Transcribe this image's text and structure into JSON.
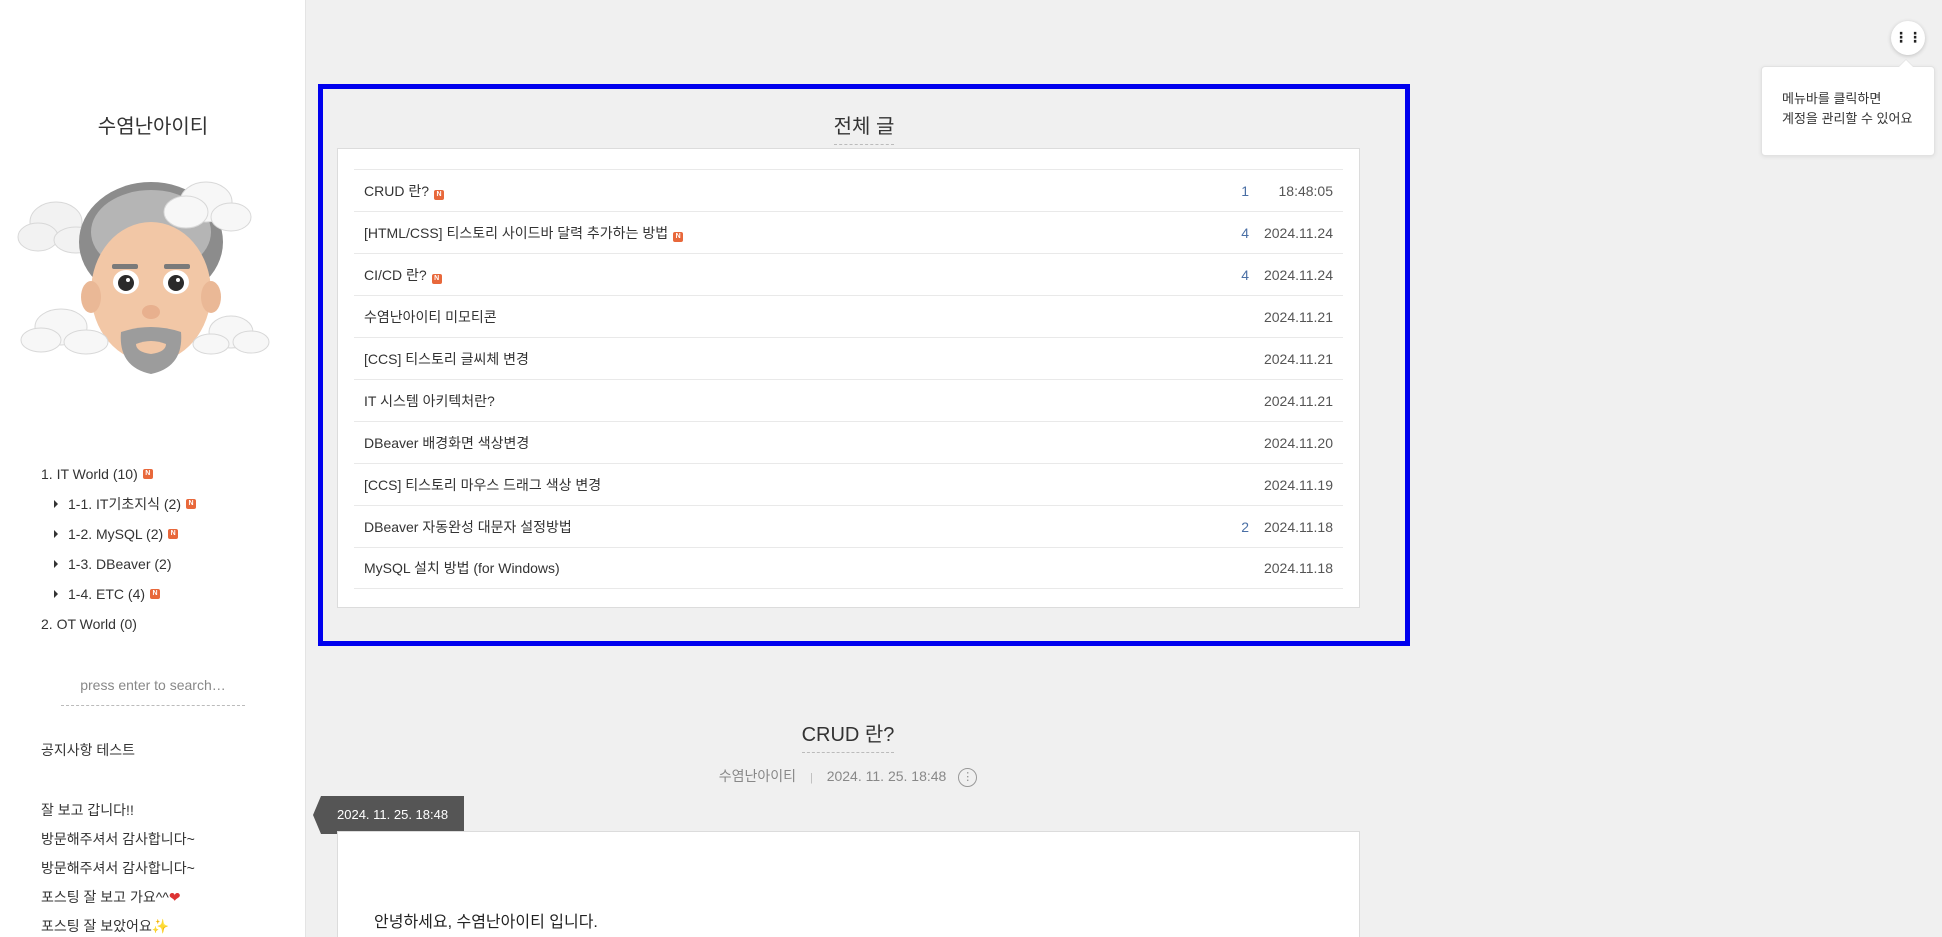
{
  "blog": {
    "title": "수염난아이티",
    "avatar": "memoji-avatar-with-clouds"
  },
  "categories": [
    {
      "label": "1. IT World (10)",
      "new": true,
      "sub": false
    },
    {
      "label": "1-1. IT기초지식 (2)",
      "new": true,
      "sub": true
    },
    {
      "label": "1-2. MySQL (2)",
      "new": true,
      "sub": true
    },
    {
      "label": "1-3. DBeaver (2)",
      "new": false,
      "sub": true
    },
    {
      "label": "1-4. ETC (4)",
      "new": true,
      "sub": true
    },
    {
      "label": "2. OT World (0)",
      "new": false,
      "sub": false
    }
  ],
  "search": {
    "placeholder": "press enter to search…"
  },
  "notice": "공지사항 테스트",
  "comments": [
    "잘 보고 갑니다!!",
    "방문해주셔서 감사합니다~",
    "방문해주셔서 감사합니다~",
    "포스팅 잘 보고 가요^^",
    "포스팅 잘 보았어요"
  ],
  "menu": {
    "icon": "menu-dots-icon",
    "tooltip_line1": "메뉴바를 클릭하면",
    "tooltip_line2": "계정을 관리할 수 있어요"
  },
  "post_list": {
    "title": "전체 글",
    "posts": [
      {
        "title": "CRUD 란?",
        "new": true,
        "count": "1",
        "date": "18:48:05"
      },
      {
        "title": "[HTML/CSS] 티스토리 사이드바 달력 추가하는 방법",
        "new": true,
        "count": "4",
        "date": "2024.11.24"
      },
      {
        "title": "CI/CD 란?",
        "new": true,
        "count": "4",
        "date": "2024.11.24"
      },
      {
        "title": "수염난아이티 미모티콘",
        "new": false,
        "count": "",
        "date": "2024.11.21"
      },
      {
        "title": "[CCS] 티스토리 글씨체 변경",
        "new": false,
        "count": "",
        "date": "2024.11.21"
      },
      {
        "title": "IT 시스템 아키텍처란?",
        "new": false,
        "count": "",
        "date": "2024.11.21"
      },
      {
        "title": "DBeaver 배경화면 색상변경",
        "new": false,
        "count": "",
        "date": "2024.11.20"
      },
      {
        "title": "[CCS] 티스토리 마우스 드래그 색상 변경",
        "new": false,
        "count": "",
        "date": "2024.11.19"
      },
      {
        "title": "DBeaver 자동완성 대문자 설정방법",
        "new": false,
        "count": "2",
        "date": "2024.11.18"
      },
      {
        "title": "MySQL 설치 방법 (for Windows)",
        "new": false,
        "count": "",
        "date": "2024.11.18"
      }
    ]
  },
  "article": {
    "title": "CRUD 란?",
    "author": "수염난아이티",
    "separator": "|",
    "datetime": "2024. 11. 25. 18:48",
    "ribbon_date": "2024. 11. 25. 18:48",
    "body_first_line": "안녕하세요, 수염난아이티 입니다."
  },
  "colors": {
    "highlight_border": "#0000ee",
    "new_badge": "#e8683b",
    "count_text": "#4a6fa5",
    "ribbon": "#555555"
  }
}
